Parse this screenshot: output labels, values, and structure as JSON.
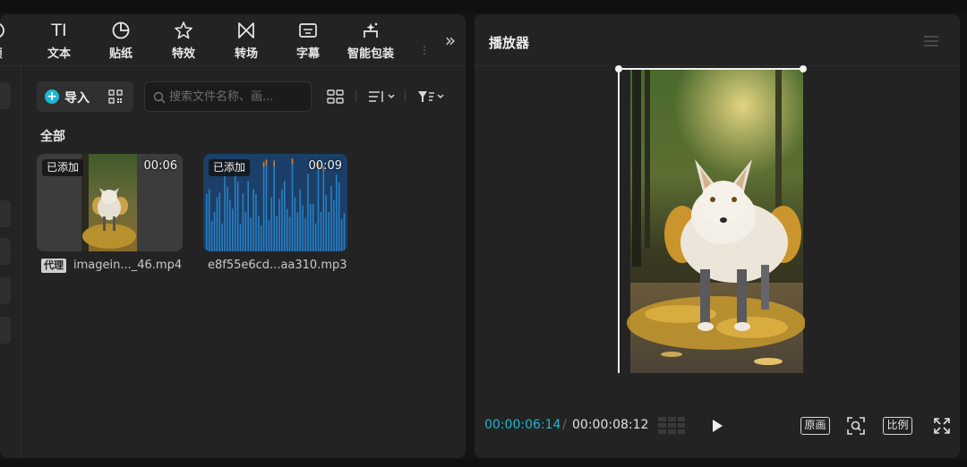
{
  "toolbar": {
    "items": [
      {
        "label": "频",
        "icon": "video-icon"
      },
      {
        "label": "文本",
        "icon": "text-icon"
      },
      {
        "label": "贴纸",
        "icon": "sticker-icon"
      },
      {
        "label": "特效",
        "icon": "effects-star-icon"
      },
      {
        "label": "转场",
        "icon": "transition-icon"
      },
      {
        "label": "字幕",
        "icon": "subtitle-icon"
      },
      {
        "label": "智能包装",
        "icon": "smart-package-icon"
      }
    ],
    "text_icon_glyph": "TI",
    "more_glyph": "»"
  },
  "media": {
    "import_label": "导入",
    "search_placeholder": "搜索文件名称、画...",
    "section_label": "全部",
    "items": [
      {
        "badge": "已添加",
        "duration": "00:06",
        "proxy": "代理",
        "filename": "imagein..._46.mp4",
        "type": "video"
      },
      {
        "badge": "已添加",
        "duration": "00:09",
        "filename": "e8f55e6cd...aa310.mp3",
        "type": "audio"
      }
    ]
  },
  "player": {
    "title": "播放器",
    "current_time": "00:00:06:14",
    "separator": "/",
    "total_time": "00:00:08:12",
    "original_label": "原画",
    "ratio_label": "比例"
  },
  "colors": {
    "accent": "#18b9d6",
    "panel": "#232323",
    "audio_wave": "#2a7fc1"
  }
}
